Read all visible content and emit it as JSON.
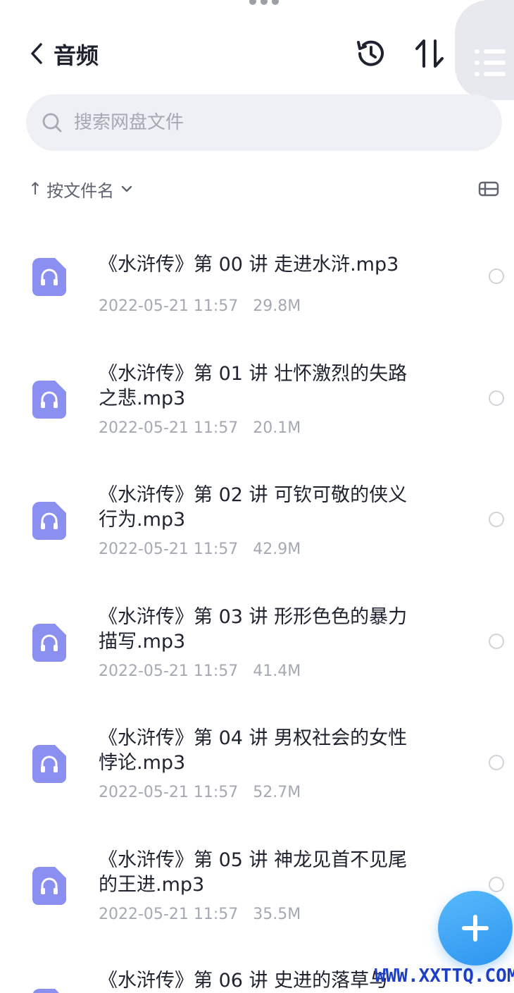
{
  "header": {
    "title": "音频",
    "back_icon": "chevron-left-icon",
    "history_icon": "history-icon",
    "sort_icon": "sort-arrows-icon",
    "menu_icon": "list-menu-icon"
  },
  "search": {
    "placeholder": "搜索网盘文件",
    "icon": "search-icon"
  },
  "sortbar": {
    "arrow": "↑",
    "label": "按文件名",
    "chevron_icon": "chevron-down-icon",
    "view_icon": "view-toggle-icon"
  },
  "files": [
    {
      "name": "《水浒传》第 00 讲 走进水浒.mp3",
      "date": "2022-05-21 11:57",
      "size": "29.8M"
    },
    {
      "name": "《水浒传》第 01 讲 壮怀激烈的失路之悲.mp3",
      "date": "2022-05-21 11:57",
      "size": "20.1M"
    },
    {
      "name": "《水浒传》第 02 讲 可钦可敬的侠义行为.mp3",
      "date": "2022-05-21 11:57",
      "size": "42.9M"
    },
    {
      "name": "《水浒传》第 03 讲 形形色色的暴力描写.mp3",
      "date": "2022-05-21 11:57",
      "size": "41.4M"
    },
    {
      "name": "《水浒传》第 04 讲 男权社会的女性悖论.mp3",
      "date": "2022-05-21 11:57",
      "size": "52.7M"
    },
    {
      "name": "《水浒传》第 05 讲 神龙见首不见尾的王进.mp3",
      "date": "2022-05-21 11:57",
      "size": "35.5M"
    },
    {
      "name": "《水浒传》第 06 讲 史进的落草与",
      "date": "",
      "size": ""
    }
  ],
  "fab": {
    "icon": "plus-icon"
  },
  "watermark": "WWW.XXTTQ.COM",
  "colors": {
    "accent": "#2d95f0",
    "file_icon": "#8b8ff0",
    "muted": "#a4a9b3"
  }
}
